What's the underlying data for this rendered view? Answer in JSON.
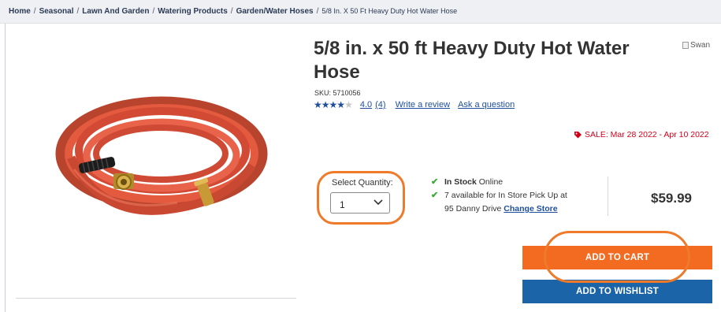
{
  "breadcrumb": {
    "items": [
      "Home",
      "Seasonal",
      "Lawn And Garden",
      "Watering Products",
      "Garden/Water Hoses"
    ],
    "current": "5/8 In. X 50 Ft Heavy Duty Hot Water Hose",
    "separator": "/"
  },
  "product": {
    "title": "5/8 in. x 50 ft Heavy Duty Hot Water Hose",
    "brand_alt": "Swan",
    "sku": "SKU: 5710056",
    "rating": {
      "value": "4.0",
      "count": "(4)",
      "stars": 4,
      "max_stars": 5
    },
    "write_review": "Write a review",
    "ask_question": "Ask a question",
    "sale": "SALE: Mar 28 2022 - Apr 10 2022",
    "price": "$59.99"
  },
  "quantity": {
    "label": "Select Quantity:",
    "value": "1"
  },
  "stock": {
    "status": "In Stock",
    "channel": "Online",
    "pickup": "7 available for In Store Pick Up at",
    "store": "95 Danny Drive",
    "change_store": "Change Store"
  },
  "actions": {
    "add_to_cart": "ADD TO CART",
    "add_to_wishlist": "ADD TO WISHLIST"
  },
  "colors": {
    "accent_orange": "#f26b21",
    "primary_blue": "#1b64a8",
    "sale_red": "#d0021b",
    "check_green": "#3aa935"
  }
}
